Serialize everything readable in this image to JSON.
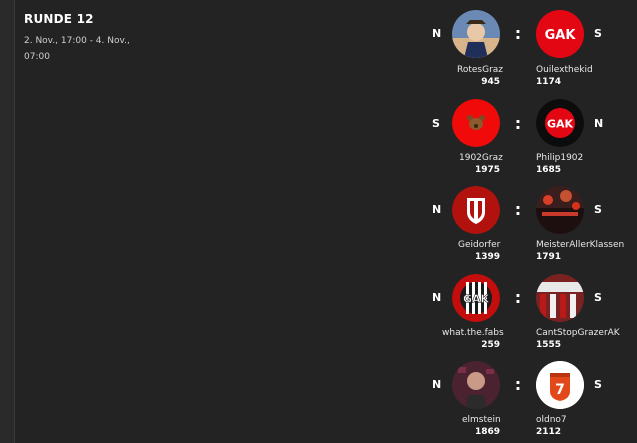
{
  "round": {
    "title": "RUNDE 12",
    "dates": "2. Nov., 17:00 - 4. Nov., 07:00"
  },
  "separator": ":",
  "matches": [
    {
      "left": {
        "side": "N",
        "name": "RotesGraz",
        "score": "945",
        "avatar": "photo-avatar"
      },
      "right": {
        "side": "S",
        "name": "Ouilexthekid",
        "score": "1174",
        "avatar": "gak-logo-red",
        "logo_text": "GAK"
      }
    },
    {
      "left": {
        "side": "S",
        "name": "1902Graz",
        "score": "1975",
        "avatar": "bear-logo-red"
      },
      "right": {
        "side": "N",
        "name": "Philip1902",
        "score": "1685",
        "avatar": "gak-logo-black",
        "logo_text": "GAK"
      }
    },
    {
      "left": {
        "side": "N",
        "name": "Geidorfer",
        "score": "1399",
        "avatar": "shield-logo-red"
      },
      "right": {
        "side": "S",
        "name": "MeisterAllerKlassen",
        "score": "1791",
        "avatar": "stadium-photo"
      }
    },
    {
      "left": {
        "side": "N",
        "name": "what.the.fabs",
        "score": "259",
        "avatar": "gak-striped-logo",
        "logo_text": "GAK"
      },
      "right": {
        "side": "S",
        "name": "CantStopGrazerAK",
        "score": "1555",
        "avatar": "fans-photo"
      }
    },
    {
      "left": {
        "side": "N",
        "name": "elmstein",
        "score": "1869",
        "avatar": "person-photo"
      },
      "right": {
        "side": "S",
        "name": "oldno7",
        "score": "2112",
        "avatar": "number-seven-logo",
        "logo_text": "7"
      }
    }
  ],
  "colors": {
    "background": "#232323",
    "brand_red": "#e30613",
    "text": "#ffffff"
  }
}
